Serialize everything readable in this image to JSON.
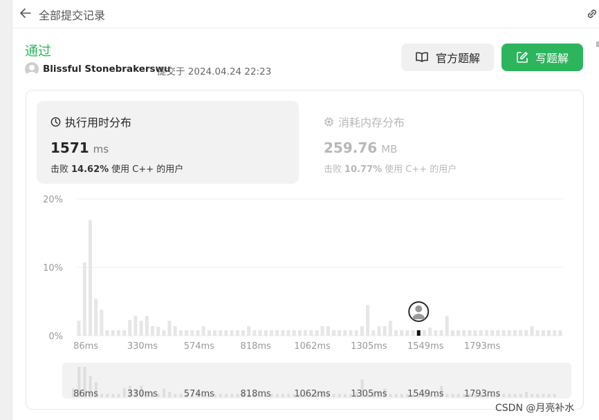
{
  "topbar": {
    "title": "全部提交记录",
    "back_icon": "arrow-left-icon",
    "link_icon": "link-icon"
  },
  "submission": {
    "status": "通过",
    "username": "Blissful Stonebrakerswu",
    "submitted_label": "提交于 2024.04.24 22:23"
  },
  "buttons": {
    "official_label": "官方题解",
    "write_label": "写题解"
  },
  "runtime": {
    "title": "执行用时分布",
    "value": "1571",
    "unit": "ms",
    "beat_prefix": "击败",
    "beat_percent": "14.62%",
    "beat_suffix": "使用 C++ 的用户"
  },
  "memory": {
    "title": "消耗内存分布",
    "value": "259.76",
    "unit": "MB",
    "beat_prefix": "击败",
    "beat_percent": "10.77%",
    "beat_suffix": "使用 C++ 的用户"
  },
  "colors": {
    "accent": "#2db55d",
    "bar": "#e6e6e6",
    "marker": "#111111"
  },
  "chart_data": {
    "type": "bar",
    "ytick_labels": [
      "20%",
      "10%",
      "0%"
    ],
    "ylim": [
      0,
      20
    ],
    "xtick_labels": [
      "86ms",
      "330ms",
      "574ms",
      "818ms",
      "1062ms",
      "1305ms",
      "1549ms",
      "1793ms"
    ],
    "values": [
      2.2,
      10.7,
      16.9,
      5.4,
      3.8,
      0.8,
      0.8,
      0.8,
      0.8,
      2.3,
      2.9,
      2.2,
      2.9,
      1.4,
      1.3,
      0.8,
      2.2,
      1.4,
      0.8,
      0.8,
      0.8,
      0.8,
      1.4,
      0.8,
      0.8,
      0.8,
      0.8,
      0.8,
      0.8,
      0.8,
      1.4,
      0.8,
      0.8,
      0.8,
      0.8,
      0.8,
      0.8,
      0.8,
      0.8,
      0.8,
      0.8,
      0.8,
      0.8,
      1.4,
      1.4,
      0.8,
      0.8,
      0.8,
      0.8,
      0.8,
      1.4,
      4.5,
      0.8,
      1.4,
      1.4,
      2.2,
      0.8,
      0.8,
      0.8,
      0.8,
      0.8,
      0.8,
      1.2,
      0.8,
      0.8,
      2.9,
      0.8,
      0.8,
      0.8,
      0.8,
      0.8,
      0.8,
      0.8,
      0.8,
      0.8,
      0.8,
      0.8,
      0.8,
      0.8,
      0.8,
      1.4,
      0.8,
      0.8,
      0.8,
      0.8,
      0.8
    ],
    "highlight_index": 60,
    "grid": true
  },
  "watermark": "CSDN @月亮补水"
}
